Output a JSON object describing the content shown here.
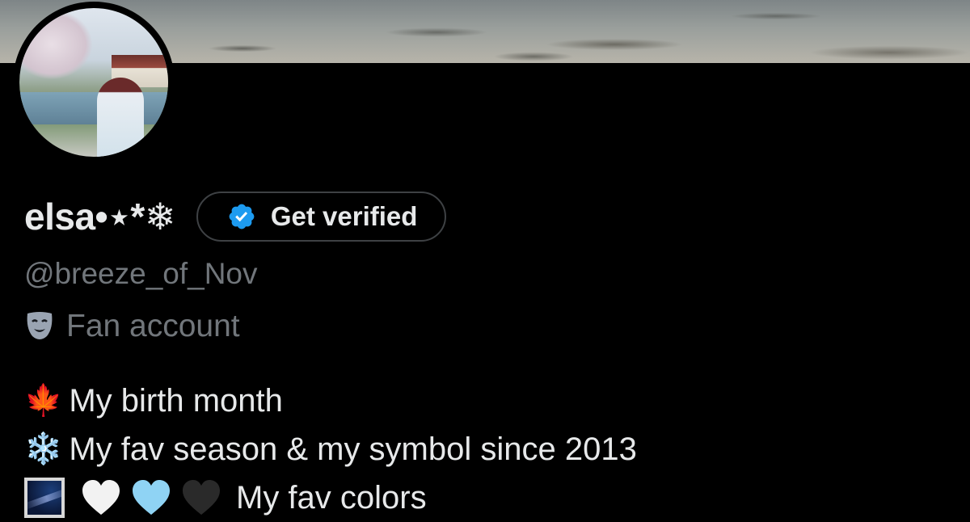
{
  "profile": {
    "display_name": "elsa•⋆*❄",
    "verify_button_label": "Get verified",
    "handle": "@breeze_of_Nov",
    "category": "Fan account"
  },
  "bio": {
    "line1_icon": "🍁",
    "line1_text": "My birth month",
    "line2_icon": "❄️",
    "line2_text": "My fav season & my symbol since 2013",
    "line3_text": "My fav colors"
  },
  "colors": {
    "background": "#000000",
    "primary_text": "#e7e9ea",
    "secondary_text": "#71767b",
    "verified_blue": "#1d9bf0",
    "heart_white": "#f2f2f2",
    "heart_blue": "#8fd3f4",
    "heart_black": "#2a2a2a"
  },
  "icons": [
    "verified-badge-icon",
    "theater-mask-icon",
    "maple-leaf-icon",
    "snowflake-icon",
    "milky-way-icon",
    "white-heart-icon",
    "light-blue-heart-icon",
    "black-heart-icon"
  ]
}
